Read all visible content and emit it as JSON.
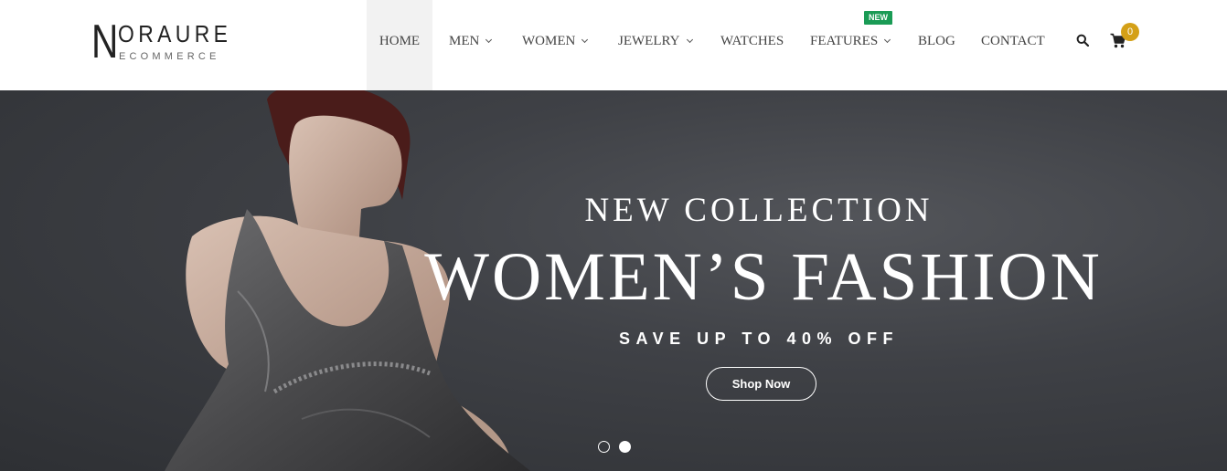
{
  "brand": {
    "initial": "N",
    "name": "ORAURE",
    "tagline": "ECOMMERCE"
  },
  "nav": {
    "items": [
      {
        "label": "HOME",
        "active": true,
        "dropdown": false
      },
      {
        "label": "MEN",
        "dropdown": true
      },
      {
        "label": "WOMEN",
        "dropdown": true
      },
      {
        "label": "JEWELRY",
        "dropdown": true
      },
      {
        "label": "WATCHES",
        "dropdown": false
      },
      {
        "label": "FEATURES",
        "dropdown": true,
        "badge": "NEW"
      },
      {
        "label": "BLOG",
        "dropdown": false
      },
      {
        "label": "CONTACT",
        "dropdown": false
      }
    ],
    "search_icon": "search-icon",
    "cart_icon": "cart-icon",
    "cart_count": "0"
  },
  "hero": {
    "eyebrow": "NEW COLLECTION",
    "headline": "WOMEN’S FASHION",
    "subtitle": "SAVE UP TO 40% OFF",
    "button_label": "Shop Now",
    "slide_count": 2,
    "active_slide": 2
  },
  "colors": {
    "badge_new": "#1a9b55",
    "cart_badge": "#d4a017",
    "hero_bg": "#3f4146",
    "nav_active_bg": "#f2f2f2"
  }
}
